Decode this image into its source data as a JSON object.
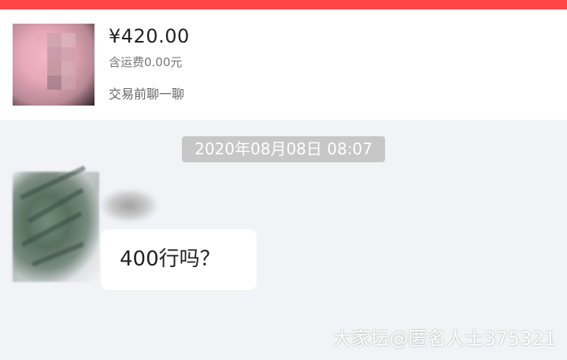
{
  "colors": {
    "top_bar": "#ff4747",
    "background": "#f2f3f7",
    "card": "#ffffff",
    "timestamp_bg": "#c7c7c7"
  },
  "product": {
    "price": "¥420.00",
    "shipping": "含运费0.00元",
    "chat_link": "交易前聊一聊"
  },
  "chat": {
    "timestamp": "2020年08月08日 08:07",
    "message": "400行吗？"
  },
  "watermark": "大家坛@匿名人士375321"
}
